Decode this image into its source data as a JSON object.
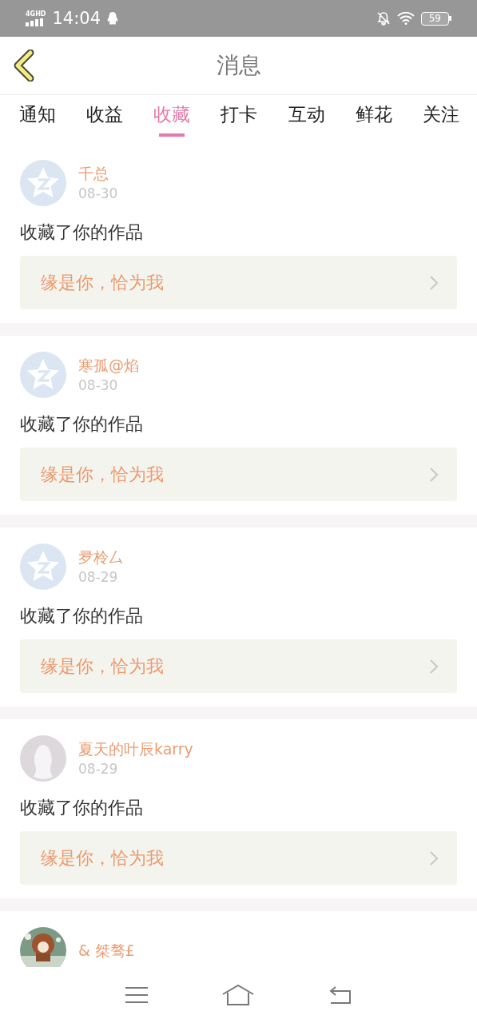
{
  "status_bar": {
    "network": "4GHD",
    "time": "14:04",
    "battery": "59"
  },
  "header": {
    "title": "消息"
  },
  "tabs": [
    {
      "label": "通知",
      "selected": false
    },
    {
      "label": "收益",
      "selected": false
    },
    {
      "label": "收藏",
      "selected": true
    },
    {
      "label": "打卡",
      "selected": false
    },
    {
      "label": "互动",
      "selected": false
    },
    {
      "label": "鲜花",
      "selected": false
    },
    {
      "label": "关注",
      "selected": false
    }
  ],
  "messages": [
    {
      "avatar": {
        "kind": "star"
      },
      "name": "千总",
      "date": "08-30",
      "action": "收藏了你的作品",
      "work": "缘是你，恰为我"
    },
    {
      "avatar": {
        "kind": "star"
      },
      "name": "寒孤@焰",
      "date": "08-30",
      "action": "收藏了你的作品",
      "work": "缘是你，恰为我"
    },
    {
      "avatar": {
        "kind": "star"
      },
      "name": "夛柃厶",
      "date": "08-29",
      "action": "收藏了你的作品",
      "work": "缘是你，恰为我"
    },
    {
      "avatar": {
        "kind": "silhouette"
      },
      "name": "夏天的叶辰karry",
      "date": "08-29",
      "action": "收藏了你的作品",
      "work": "缘是你，恰为我"
    },
    {
      "name": "& 桀骜£"
    }
  ]
}
